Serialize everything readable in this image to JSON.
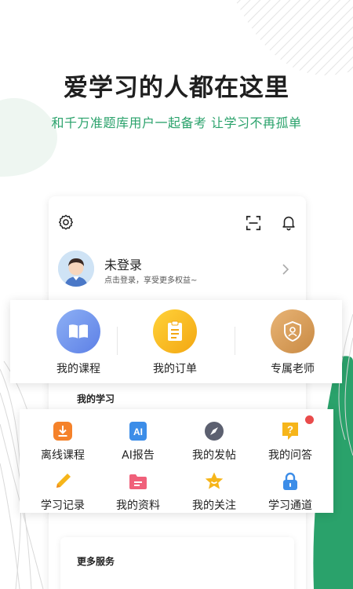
{
  "hero": {
    "title": "爱学习的人都在这里",
    "subtitle": "和千万准题库用户一起备考 让学习不再孤单"
  },
  "colors": {
    "accent_green": "#2aa26b",
    "blue": "#5d8cec",
    "yellow": "#f6b51a",
    "bronze": "#d4974f",
    "badge_red": "#e94b4b"
  },
  "header": {
    "icons": [
      "settings-icon",
      "scan-icon",
      "bell-icon"
    ]
  },
  "user": {
    "name": "未登录",
    "tip": "点击登录，享受更多权益~"
  },
  "quick": [
    {
      "label": "我的课程",
      "icon": "book-icon"
    },
    {
      "label": "我的订单",
      "icon": "clipboard-icon"
    },
    {
      "label": "专属老师",
      "icon": "teacher-badge-icon"
    }
  ],
  "study": {
    "title": "我的学习",
    "items": [
      {
        "label": "离线课程",
        "icon": "download-icon"
      },
      {
        "label": "AI报告",
        "icon": "ai-icon"
      },
      {
        "label": "我的发帖",
        "icon": "compass-icon"
      },
      {
        "label": "我的问答",
        "icon": "question-icon"
      },
      {
        "label": "学习记录",
        "icon": "pencil-icon"
      },
      {
        "label": "我的资料",
        "icon": "folder-icon"
      },
      {
        "label": "我的关注",
        "icon": "star-icon"
      },
      {
        "label": "学习通道",
        "icon": "lock-icon"
      }
    ]
  },
  "more": {
    "title": "更多服务"
  }
}
